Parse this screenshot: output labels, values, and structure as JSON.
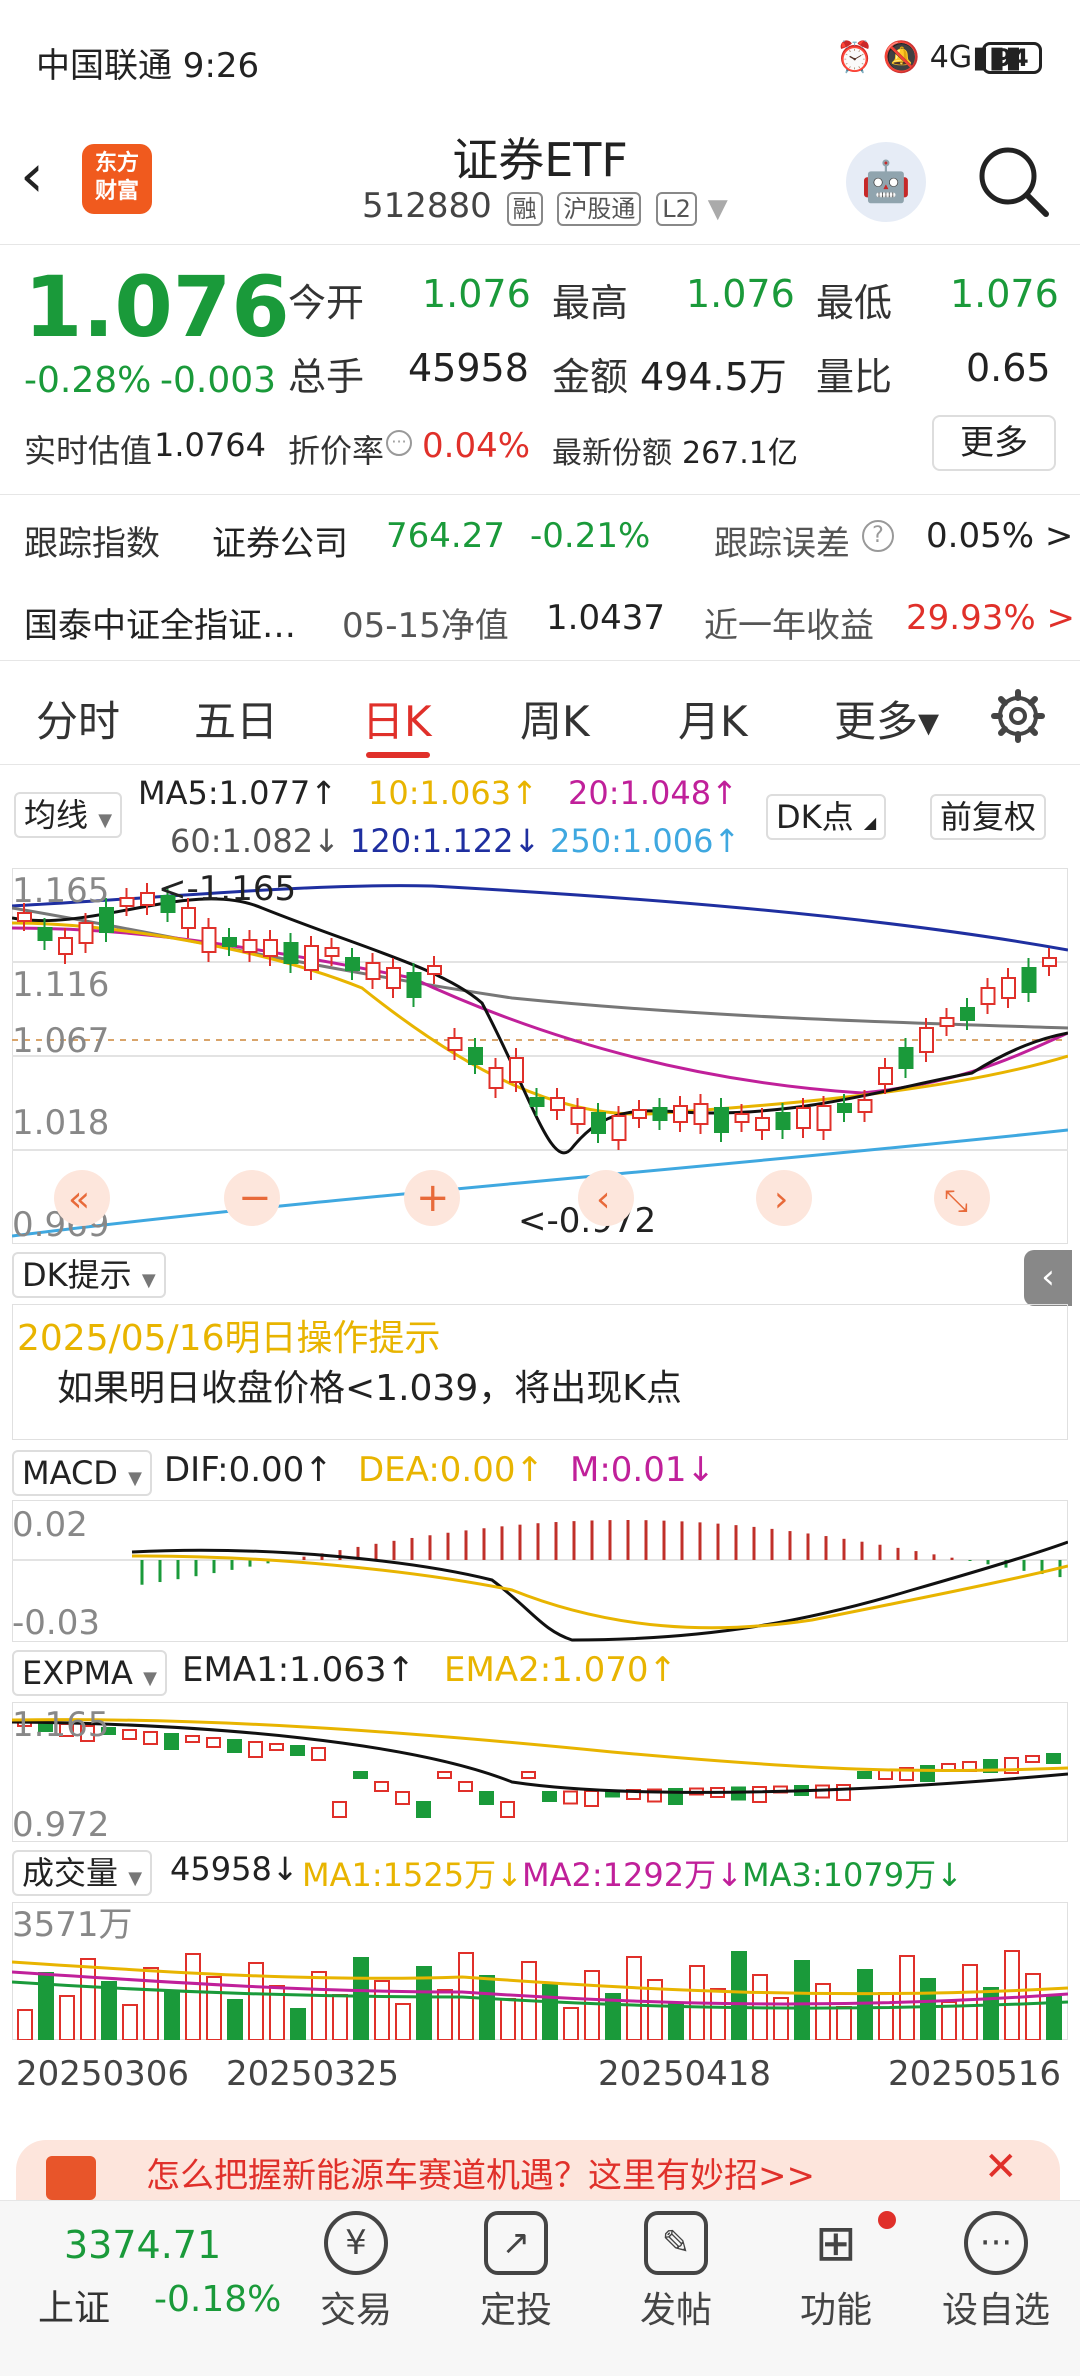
{
  "status_bar": {
    "carrier_time": "中国联通 9:26",
    "battery": "94"
  },
  "header": {
    "logo_text": "东方\n财富",
    "title": "证券ETF",
    "code": "512880",
    "badges": [
      "融",
      "沪股通",
      "L2"
    ]
  },
  "quote": {
    "price": "1.076",
    "change_pct": "-0.28%",
    "change": "-0.003",
    "open_label": "今开",
    "open": "1.076",
    "high_label": "最高",
    "high": "1.076",
    "low_label": "最低",
    "low": "1.076",
    "volume_label": "总手",
    "volume": "45958",
    "amount_label": "金额",
    "amount": "494.5万",
    "ratio_label": "量比",
    "ratio": "0.65",
    "iopv_label": "实时估值",
    "iopv": "1.0764",
    "discount_label": "折价率",
    "discount": "0.04%",
    "shares_label": "最新份额",
    "shares": "267.1亿",
    "more_label": "更多"
  },
  "tracking": {
    "index_label": "跟踪指数",
    "index_name": "证券公司",
    "index_value": "764.27",
    "index_change": "-0.21%",
    "error_label": "跟踪误差",
    "error_value": "0.05% >",
    "fund_name": "国泰中证全指证…",
    "nav_label": "05-15净值",
    "nav_value": "1.0437",
    "yield_label": "近一年收益",
    "yield_value": "29.93% >"
  },
  "tabs": [
    "分时",
    "五日",
    "日K",
    "周K",
    "月K",
    "更多▾"
  ],
  "active_tab": "日K",
  "kline": {
    "indicator_select": "均线",
    "ma": [
      {
        "label": "MA5:1.077↑",
        "color": "#222222"
      },
      {
        "label": "10:1.063↑",
        "color": "#e8b400"
      },
      {
        "label": "20:1.048↑",
        "color": "#c0209a"
      },
      {
        "label": "60:1.082↓",
        "color": "#555555"
      },
      {
        "label": "120:1.122↓",
        "color": "#1f2fa0"
      },
      {
        "label": "250:1.006↑",
        "color": "#3fa8e0"
      }
    ],
    "dk_select": "DK点",
    "adjust_btn": "前复权",
    "y_labels": [
      "1.165",
      "1.116",
      "1.067",
      "1.018",
      "0.969"
    ],
    "max_marker": "<-1.165",
    "min_marker": "<-0.972"
  },
  "dk": {
    "select": "DK提示",
    "date_line": "2025/05/16明日操作提示",
    "tip": "如果明日收盘价格<1.039，将出现K点"
  },
  "macd": {
    "select": "MACD",
    "dif": "DIF:0.00↑",
    "dea": "DEA:0.00↑",
    "m": "M:0.01↓",
    "y_labels": [
      "0.02",
      "-0.03"
    ]
  },
  "expma": {
    "select": "EXPMA",
    "ema1": "EMA1:1.063↑",
    "ema2": "EMA2:1.070↑",
    "y_labels": [
      "1.165",
      "0.972"
    ]
  },
  "volume_panel": {
    "select": "成交量",
    "vol": "45958↓",
    "ma1": "MA1:1525万↓",
    "ma2": "MA2:1292万↓",
    "ma3": "MA3:1079万↓",
    "y_label": "3571万",
    "dates": [
      "20250306",
      "20250325",
      "20250418",
      "20250516"
    ]
  },
  "banner": {
    "text": "怎么把握新能源车赛道机遇？这里有妙招>>"
  },
  "bottom_nav": {
    "index_value": "3374.71",
    "index_name": "上证",
    "index_change": "-0.18%",
    "items": [
      "交易",
      "定投",
      "发帖",
      "功能",
      "设自选"
    ]
  }
}
